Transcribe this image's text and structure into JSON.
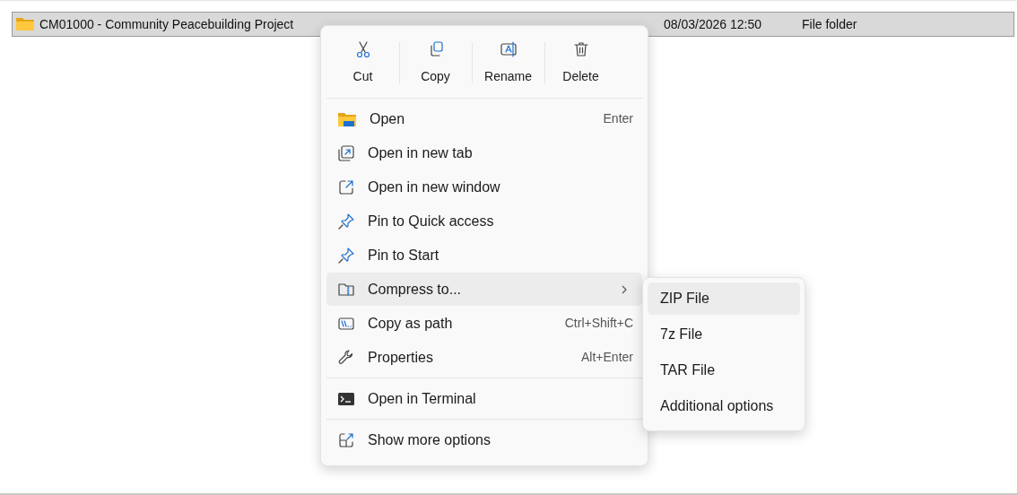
{
  "file_row": {
    "name": "CM01000 - Community Peacebuilding Project",
    "date": "08/03/2026 12:50",
    "type": "File folder",
    "selected": true
  },
  "context_menu": {
    "actions": [
      {
        "label": "Cut",
        "kind": "cut"
      },
      {
        "label": "Copy",
        "kind": "copy"
      },
      {
        "label": "Rename",
        "kind": "rename"
      },
      {
        "label": "Delete",
        "kind": "delete"
      }
    ],
    "sections": [
      [
        {
          "label": "Open",
          "shortcut": "Enter",
          "kind": "open",
          "selected": false,
          "submenu": false
        },
        {
          "label": "Open in new tab",
          "kind": "new-tab",
          "selected": false,
          "submenu": false
        },
        {
          "label": "Open in new window",
          "kind": "new-window",
          "selected": false,
          "submenu": false
        },
        {
          "label": "Pin to Quick access",
          "kind": "pin",
          "selected": false,
          "submenu": false
        },
        {
          "label": "Pin to Start",
          "kind": "pin",
          "selected": false,
          "submenu": false
        },
        {
          "label": "Compress to...",
          "kind": "compress",
          "selected": true,
          "submenu": true
        },
        {
          "label": "Copy as path",
          "shortcut": "Ctrl+Shift+C",
          "kind": "copy-path",
          "selected": false,
          "submenu": false
        },
        {
          "label": "Properties",
          "shortcut": "Alt+Enter",
          "kind": "properties",
          "selected": false,
          "submenu": false
        }
      ],
      [
        {
          "label": "Open in Terminal",
          "kind": "terminal",
          "selected": false,
          "submenu": false
        }
      ],
      [
        {
          "label": "Show more options",
          "kind": "more",
          "selected": false,
          "submenu": false
        }
      ]
    ]
  },
  "submenu": {
    "items": [
      {
        "label": "ZIP File",
        "selected": true
      },
      {
        "label": "7z File",
        "selected": false
      },
      {
        "label": "TAR File",
        "selected": false
      },
      {
        "label": "Additional options",
        "selected": false
      }
    ]
  }
}
